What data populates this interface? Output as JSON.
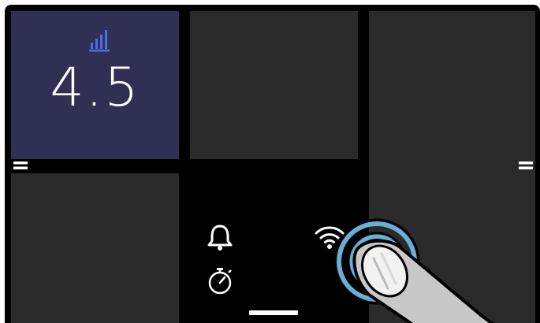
{
  "tiles": {
    "value_tile": {
      "value": "4.5",
      "icon": "signal-bars-icon",
      "accent": "#4f6fe8",
      "background": "#2f3054"
    },
    "empty_tile_color": "#2a2a2a"
  },
  "panel": {
    "icons": [
      "bell-icon",
      "timer-icon",
      "wifi-icon"
    ]
  },
  "handles": [
    "drag-handle-icon",
    "drag-handle-icon"
  ],
  "touch": {
    "ring_color": "#6aaed6"
  }
}
